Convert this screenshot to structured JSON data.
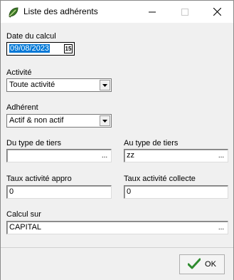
{
  "window": {
    "title": "Liste des adhérents"
  },
  "form": {
    "date_calcul": {
      "label": "Date du calcul",
      "value": "09/08/2023",
      "calendar_glyph": "15"
    },
    "activite": {
      "label": "Activité",
      "value": "Toute activité"
    },
    "adherent": {
      "label": "Adhérent",
      "value": "Actif & non actif"
    },
    "du_type_tiers": {
      "label": "Du type de tiers",
      "value": "",
      "button": "..."
    },
    "au_type_tiers": {
      "label": "Au type de tiers",
      "value": "zz",
      "button": "..."
    },
    "taux_appro": {
      "label": "Taux activité appro",
      "value": "0"
    },
    "taux_collecte": {
      "label": "Taux activité collecte",
      "value": "0"
    },
    "calcul_sur": {
      "label": "Calcul sur",
      "value": "CAPITAL",
      "button": "..."
    }
  },
  "footer": {
    "ok_label": "OK"
  },
  "icons": {
    "app": "leaf-icon",
    "ok": "checkmark-icon"
  },
  "colors": {
    "accent": "#0078d7",
    "ok_check": "#2e8b2e"
  }
}
